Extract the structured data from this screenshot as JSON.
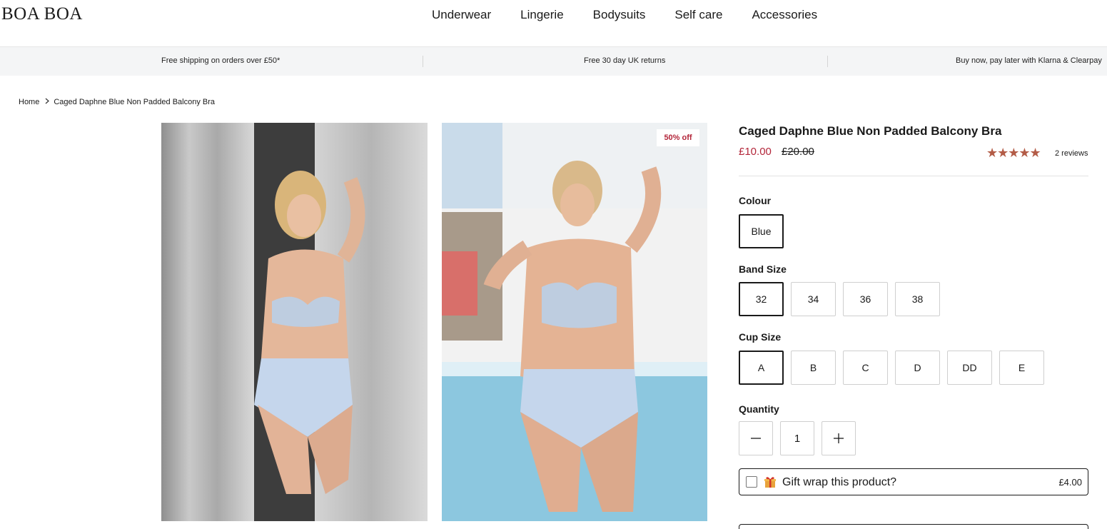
{
  "header": {
    "logo": "BOA BOA",
    "nav": [
      "Underwear",
      "Lingerie",
      "Bodysuits",
      "Self care",
      "Accessories"
    ]
  },
  "usp_bar": {
    "items": [
      "Free shipping on orders over £50*",
      "Free 30 day UK returns",
      "Buy now, pay later with Klarna & Clearpay"
    ]
  },
  "breadcrumb": {
    "home": "Home",
    "current": "Caged Daphne Blue Non Padded Balcony Bra"
  },
  "gallery": {
    "badge": "50% off"
  },
  "product": {
    "title": "Caged Daphne Blue Non Padded Balcony Bra",
    "price": "£10.00",
    "compare_price": "£20.00",
    "rating_stars": "★★★★★",
    "rating_value": 5,
    "reviews": "2 reviews",
    "colour_label": "Colour",
    "colours": [
      "Blue"
    ],
    "colour_selected": "Blue",
    "band_label": "Band Size",
    "bands": [
      "32",
      "34",
      "36",
      "38"
    ],
    "band_selected": "32",
    "cup_label": "Cup Size",
    "cups": [
      "A",
      "B",
      "C",
      "D",
      "DD",
      "E"
    ],
    "cup_selected": "A",
    "quantity_label": "Quantity",
    "quantity": "1",
    "gift_label": "Gift wrap this product?",
    "gift_price": "£4.00"
  },
  "colors": {
    "sale_red": "#b3263a",
    "star_color": "#b35c47",
    "usp_bg": "#f4f5f6"
  },
  "icons": {
    "minus": "minus-icon",
    "plus": "plus-icon",
    "gift": "gift-icon",
    "chevron": "chevron-right-icon"
  }
}
